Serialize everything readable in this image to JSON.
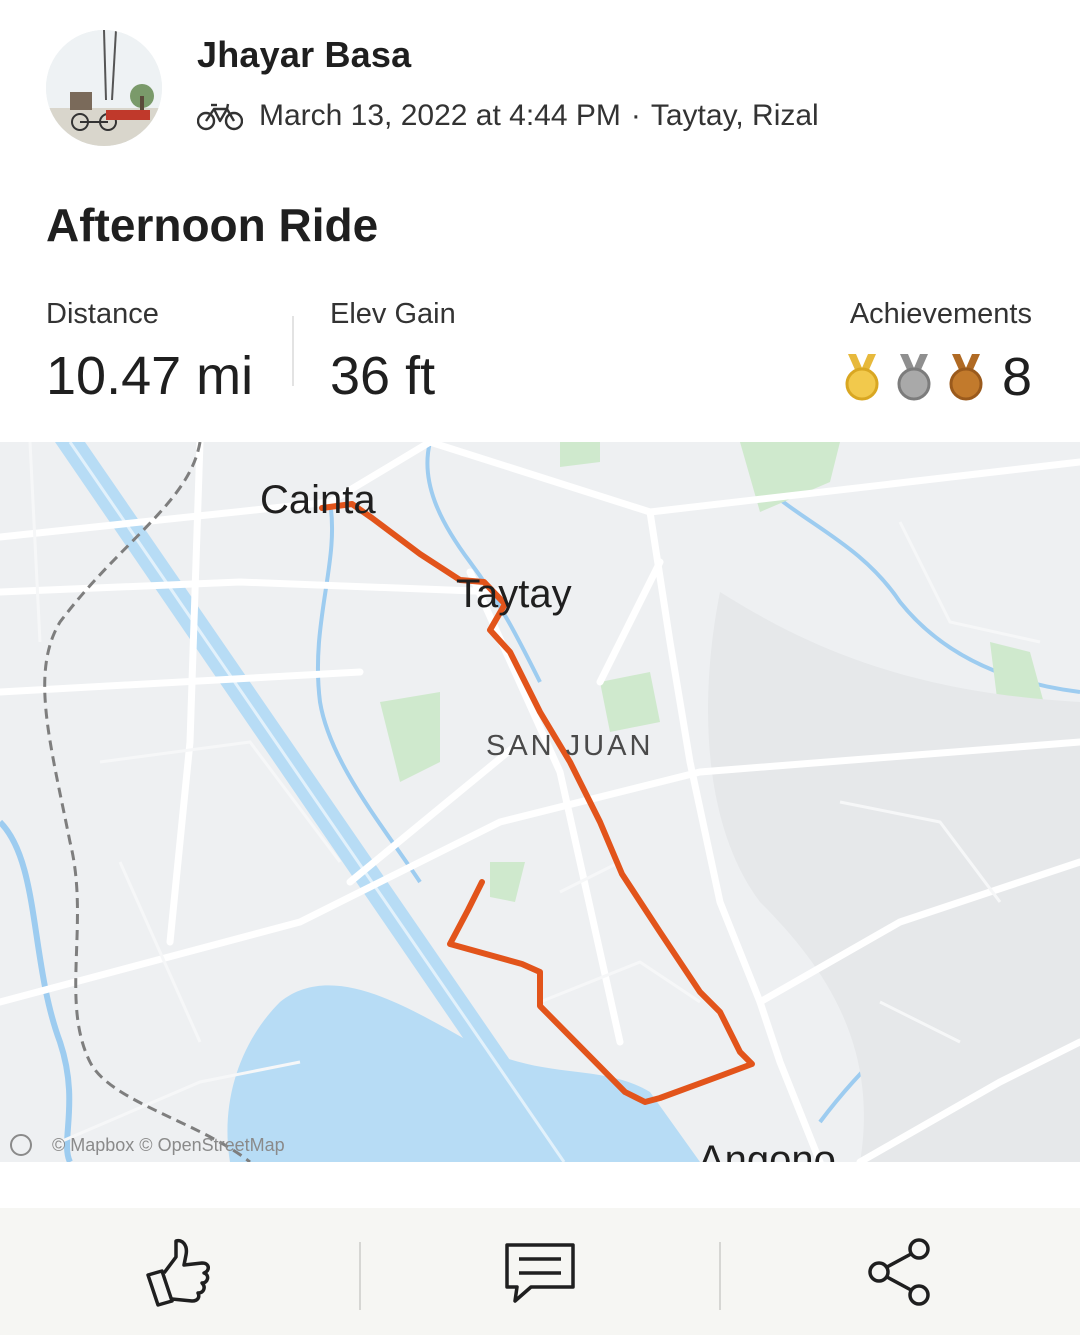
{
  "activity": {
    "athlete_name": "Jhayar Basa",
    "date": "March 13, 2022 at 4:44 PM",
    "separator": "·",
    "location": "Taytay, Rizal",
    "title": "Afternoon Ride",
    "type_icon": "bike-icon"
  },
  "stats": {
    "distance": {
      "label": "Distance",
      "value": "10.47 mi"
    },
    "elevation": {
      "label": "Elev Gain",
      "value": "36 ft"
    },
    "achievements": {
      "label": "Achievements",
      "count": "8",
      "medals": [
        "gold-medal-icon",
        "silver-medal-icon",
        "bronze-medal-icon"
      ]
    }
  },
  "map": {
    "places": {
      "cainta": "Cainta",
      "taytay": "Taytay",
      "san_juan": "SAN JUAN",
      "angono": "Angono"
    },
    "attribution": "© Mapbox © OpenStreetMap",
    "route_color": "#e2541b",
    "water_color": "#b7dcf5",
    "park_color": "#cfe9cd"
  },
  "actions": [
    {
      "name": "kudos",
      "icon": "thumbs-up-icon"
    },
    {
      "name": "comment",
      "icon": "comment-icon"
    },
    {
      "name": "share",
      "icon": "share-icon"
    }
  ],
  "colors": {
    "text": "#1f1f1f",
    "gold": "#f2c94c",
    "silver": "#9e9e9e",
    "bronze": "#c27a2c",
    "action_bar": "#f6f6f3"
  }
}
